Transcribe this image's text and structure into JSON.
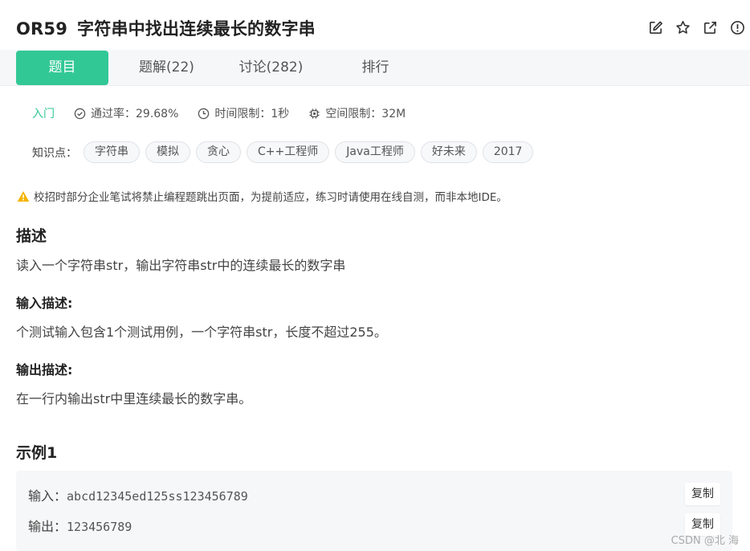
{
  "problem": {
    "code": "OR59",
    "title": "字符串中找出连续最长的数字串"
  },
  "header_icons": [
    "edit-icon",
    "star-icon",
    "share-icon",
    "info-icon"
  ],
  "tabs": [
    {
      "label": "题目",
      "active": true
    },
    {
      "label": "题解(22)",
      "active": false
    },
    {
      "label": "讨论(282)",
      "active": false
    },
    {
      "label": "排行",
      "active": false
    }
  ],
  "meta": {
    "level": "入门",
    "pass_rate": "通过率：29.68%",
    "time_limit": "时间限制：1秒",
    "space_limit": "空间限制：32M"
  },
  "tags": {
    "label": "知识点：",
    "items": [
      "字符串",
      "模拟",
      "贪心",
      "C++工程师",
      "Java工程师",
      "好未来",
      "2017"
    ]
  },
  "warning": "校招时部分企业笔试将禁止编程题跳出页面，为提前适应，练习时请使用在线自测，而非本地IDE。",
  "description": {
    "heading": "描述",
    "text": "读入一个字符串str，输出字符串str中的连续最长的数字串"
  },
  "input_desc": {
    "heading": "输入描述:",
    "text": "个测试输入包含1个测试用例，一个字符串str，长度不超过255。"
  },
  "output_desc": {
    "heading": "输出描述:",
    "text": "在一行内输出str中里连续最长的数字串。"
  },
  "example": {
    "heading": "示例1",
    "input_label": "输入：",
    "input_value": "abcd12345ed125ss123456789",
    "output_label": "输出：",
    "output_value": "123456789",
    "copy_label": "复制"
  },
  "watermark": "CSDN @北   海",
  "colors": {
    "accent": "#32c896",
    "warning": "#f5b400",
    "tab_bar": "#f6f7f9"
  }
}
